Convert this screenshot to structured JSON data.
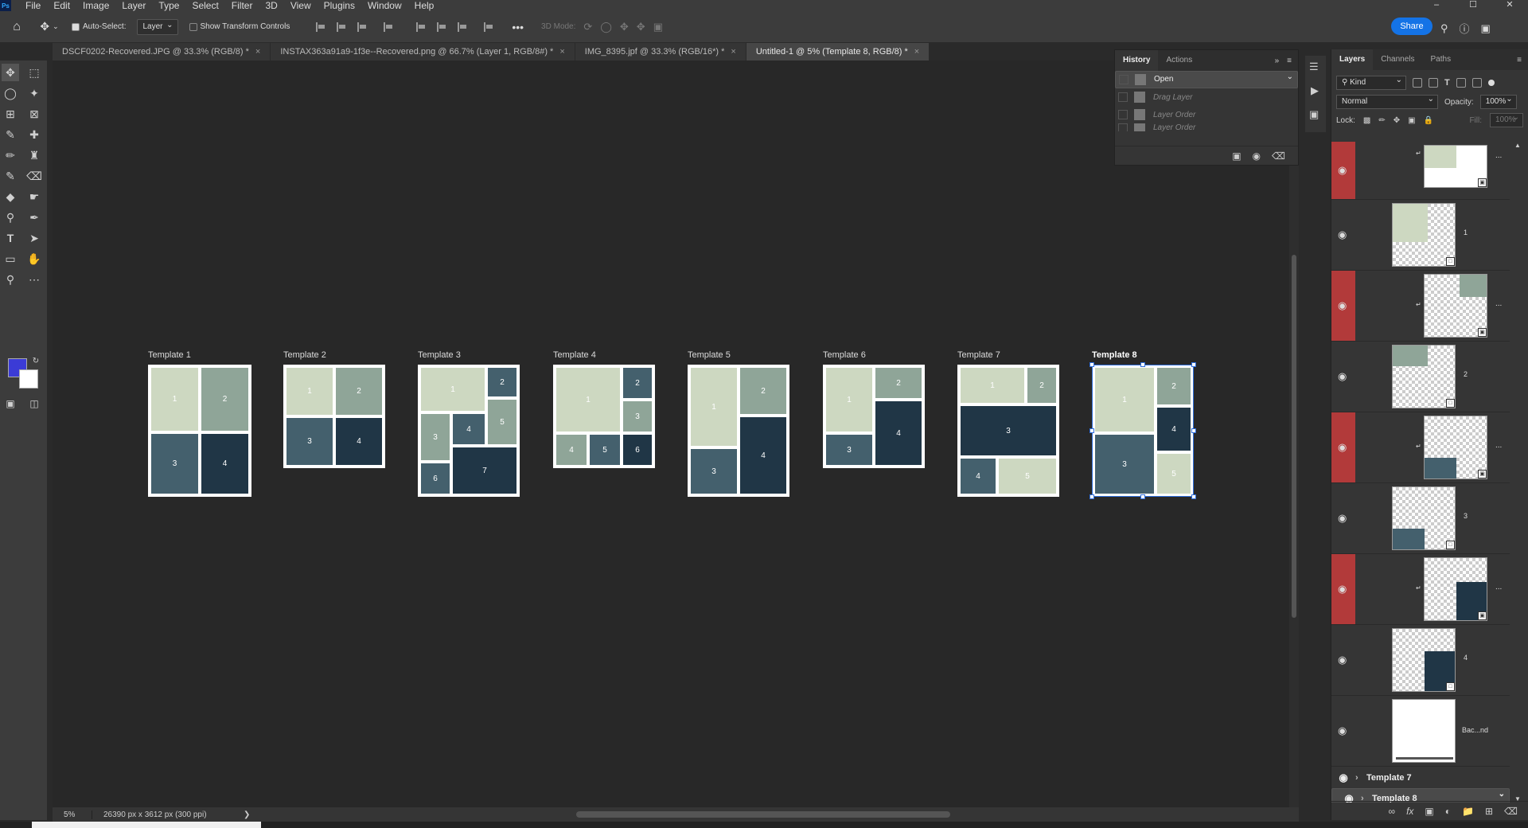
{
  "app": {
    "logo": "Ps"
  },
  "menu": [
    "File",
    "Edit",
    "Image",
    "Layer",
    "Type",
    "Select",
    "Filter",
    "3D",
    "View",
    "Plugins",
    "Window",
    "Help"
  ],
  "window_controls": [
    "–",
    "☐",
    "✕"
  ],
  "options": {
    "auto_select_label": "Auto-Select:",
    "auto_select_value": "Layer",
    "show_transform_label": "Show Transform Controls",
    "mode_3d_label": "3D Mode:",
    "share_label": "Share"
  },
  "tabs": [
    {
      "label": "DSCF0202-Recovered.JPG @ 33.3% (RGB/8) *"
    },
    {
      "label": "INSTAX363a91a9-1f3e--Recovered.png @ 66.7% (Layer 1, RGB/8#) *"
    },
    {
      "label": "IMG_8395.jpf @ 33.3% (RGB/16*) *"
    },
    {
      "label": "Untitled-1 @ 5% (Template 8, RGB/8) *"
    }
  ],
  "tab_close": "×",
  "colors": {
    "foreground": "#3b3bd6",
    "background": "#ffffff",
    "accent": "#1473e6"
  },
  "templates": [
    {
      "label": "Template 1"
    },
    {
      "label": "Template 2"
    },
    {
      "label": "Template 3"
    },
    {
      "label": "Template 4"
    },
    {
      "label": "Template 5"
    },
    {
      "label": "Template 6"
    },
    {
      "label": "Template 7"
    },
    {
      "label": "Template 8"
    }
  ],
  "status": {
    "zoom": "5%",
    "dimensions": "26390 px x 3612 px (300 ppi)"
  },
  "history": {
    "tabs": [
      "History",
      "Actions"
    ],
    "items": [
      {
        "label": "Open"
      },
      {
        "label": "Drag Layer"
      },
      {
        "label": "Layer Order"
      },
      {
        "label": "Layer Order"
      }
    ]
  },
  "layers": {
    "tabs": [
      "Layers",
      "Channels",
      "Paths"
    ],
    "filter_kind": "Kind",
    "blend_mode": "Normal",
    "opacity_label": "Opacity:",
    "opacity_value": "100%",
    "lock_label": "Lock:",
    "fill_label": "Fill:",
    "fill_value": "100%",
    "items": [
      {
        "name": "",
        "has_dots": true
      },
      {
        "name": "1"
      },
      {
        "name": "",
        "has_dots": true
      },
      {
        "name": "2"
      },
      {
        "name": "",
        "has_dots": true
      },
      {
        "name": "3"
      },
      {
        "name": "",
        "has_dots": true
      },
      {
        "name": "4"
      },
      {
        "name": "Bac...nd"
      }
    ],
    "groups": [
      "Template 7",
      "Template 8"
    ],
    "dots": "..."
  }
}
